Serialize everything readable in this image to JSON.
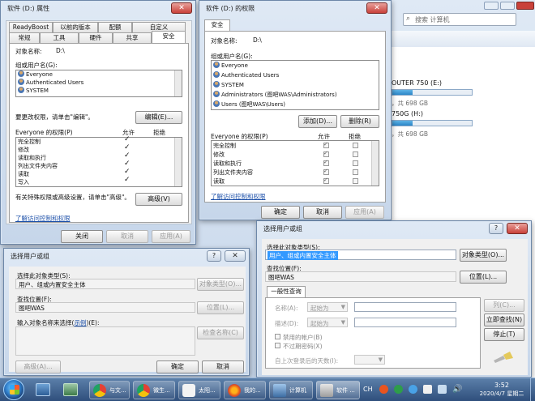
{
  "explorer": {
    "search_placeholder": "搜索 计算机",
    "drive_e_label": "OUTER 750 (E:)",
    "drive_e_free": "，共 698 GB",
    "drive_h_label": "750G (H:)",
    "drive_h_free": "，共 698 GB",
    "drive_e_fill": 0.25,
    "drive_h_fill": 0.25
  },
  "props": {
    "title": "软件 (D:) 属性",
    "tabs_row1": [
      "ReadyBoost",
      "以前的版本",
      "配额",
      "自定义"
    ],
    "tabs_row2": [
      "常规",
      "工具",
      "硬件",
      "共享",
      "安全"
    ],
    "object_label": "对象名称:",
    "object_value": "D:\\",
    "group_label": "组或用户名(G):",
    "users": [
      "Everyone",
      "Authenticated Users",
      "SYSTEM"
    ],
    "change_hint": "要更改权限，请单击\"编辑\"。",
    "edit_button": "编辑(E)...",
    "perm_header": "Everyone 的权限(P)",
    "allow": "允许",
    "deny": "拒绝",
    "perms": [
      "完全控制",
      "修改",
      "读取和执行",
      "列出文件夹内容",
      "读取",
      "写入"
    ],
    "perm_allow": [
      true,
      true,
      true,
      true,
      true,
      true
    ],
    "special_hint": "有关特殊权限或高级设置，请单击\"高级\"。",
    "advanced_button": "高级(V)",
    "link": "了解访问控制和权限",
    "close": "关闭",
    "cancel": "取消",
    "apply": "应用(A)"
  },
  "perm": {
    "title": "软件 (D:) 的权限",
    "tab": "安全",
    "object_label": "对象名称:",
    "object_value": "D:\\",
    "group_label": "组或用户名(G):",
    "users": [
      "Everyone",
      "Authenticated Users",
      "SYSTEM",
      "Administrators (图吧WAS\\Administrators)",
      "Users (图吧WAS\\Users)"
    ],
    "add": "添加(D)...",
    "remove": "删除(R)",
    "perm_header": "Everyone 的权限(P)",
    "allow": "允许",
    "deny": "拒绝",
    "perms": [
      "完全控制",
      "修改",
      "读取和执行",
      "列出文件夹内容",
      "读取"
    ],
    "perm_allow": [
      true,
      true,
      true,
      true,
      true
    ],
    "perm_deny": [
      false,
      false,
      false,
      false,
      false
    ],
    "link": "了解访问控制和权限",
    "ok": "确定",
    "cancel": "取消",
    "apply": "应用(A)"
  },
  "sel1": {
    "title": "选择用户或组",
    "type_label": "选择此对象类型(S):",
    "type_value": "用户、组或内置安全主体",
    "type_button": "对象类型(O)...",
    "loc_label": "查找位置(F):",
    "loc_value": "图吧WAS",
    "loc_button": "位置(L)...",
    "name_label_pre": "输入对象名称来选择(",
    "name_label_link": "示例",
    "name_label_post": ")(E):",
    "check_button": "检查名称(C)",
    "advanced": "高级(A)...",
    "ok": "确定",
    "cancel": "取消"
  },
  "sel2": {
    "title": "选择用户或组",
    "type_label": "选择此对象类型(S):",
    "type_value": "用户、组或内置安全主体",
    "type_button": "对象类型(O)...",
    "loc_label": "查找位置(F):",
    "loc_value": "图吧WAS",
    "loc_button": "位置(L)...",
    "tab": "一般性查询",
    "name_label": "名称(A):",
    "desc_label": "描述(D):",
    "starts_with": "起始为",
    "disabled_accounts": "禁用的帐户(B)",
    "no_expire": "不过期密码(X)",
    "days_label": "自上次登录后的天数(I):",
    "col_button": "列(C)...",
    "find_now": "立即查找(N)",
    "stop": "停止(T)"
  },
  "taskbar": {
    "items": [
      "与文...",
      "微生...",
      "太阳...",
      "我的...",
      "计算机",
      "软件 ..."
    ],
    "time": "3:52",
    "date": "2020/4/7 星期二",
    "tray": "CH"
  }
}
